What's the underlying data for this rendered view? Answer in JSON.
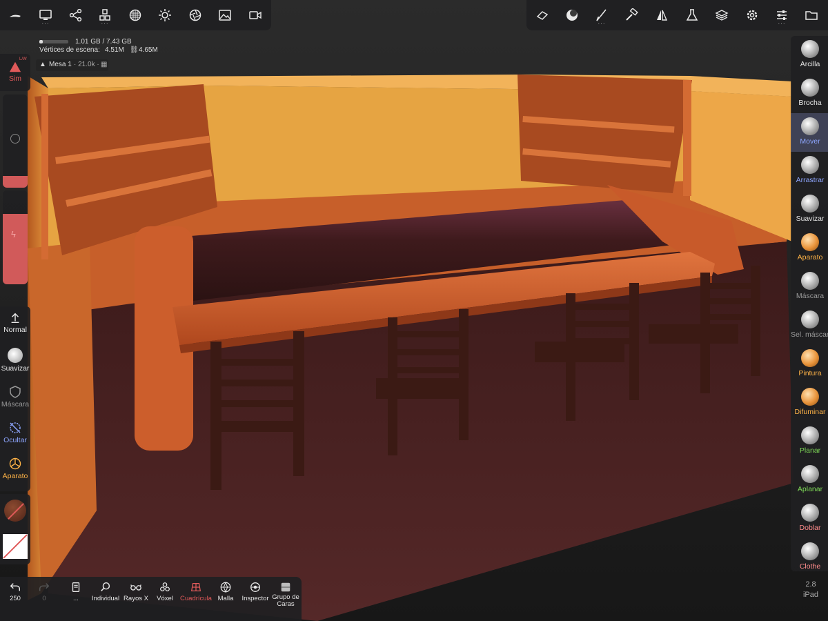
{
  "colors": {
    "accent_red": "#e05a5a",
    "accent_blue": "#8ea6ff",
    "accent_orange": "#ffb347",
    "accent_green": "#7ed957",
    "wall_top": "#e8a24a",
    "wood": "#c85c2c",
    "floor": "#4a2424",
    "chair": "#3a1a14"
  },
  "top_toolbar_left": {
    "icons": [
      "logo-icon",
      "monitor-icon",
      "nodes-icon",
      "cubes-icon",
      "sphere-grid-icon",
      "sun-icon",
      "aperture-icon",
      "image-icon",
      "camera-icon"
    ]
  },
  "top_toolbar_right": {
    "icons": [
      "eraser-icon",
      "material-ball-icon",
      "brush-icon",
      "hammer-icon",
      "symmetry-icon",
      "flask-icon",
      "layers-icon",
      "gear-icon",
      "sliders-icon",
      "folder-icon"
    ]
  },
  "stats": {
    "memory": "1.01 GB / 7.43 GB",
    "vertices_label": "Vértices de escena:",
    "vertices_value": "4.51M",
    "vertices_link": "4.65M",
    "object_name": "Mesa 1",
    "object_count": "· 21.0k ·"
  },
  "left_panel": {
    "sim_label": "Sim",
    "sim_badge": "L/W",
    "normal_label": "Normal",
    "suavizar_label": "Suavizar",
    "mascara_label": "Máscara",
    "ocultar_label": "Ocultar",
    "aparato_label": "Aparato"
  },
  "right_tools": [
    {
      "label": "Arcilla",
      "color": "#e6e6e6"
    },
    {
      "label": "Brocha",
      "color": "#e6e6e6"
    },
    {
      "label": "Mover",
      "color": "#8ea6ff",
      "active": true
    },
    {
      "label": "Arrastrar",
      "color": "#8ea6ff"
    },
    {
      "label": "Suavizar",
      "color": "#e6e6e6"
    },
    {
      "label": "Aparato",
      "color": "#ffb347"
    },
    {
      "label": "Máscara",
      "color": "#9a9a9a"
    },
    {
      "label": "Sel. máscara",
      "color": "#9a9a9a"
    },
    {
      "label": "Pintura",
      "color": "#ffb347"
    },
    {
      "label": "Difuminar",
      "color": "#ffb347"
    },
    {
      "label": "Planar",
      "color": "#7ed957"
    },
    {
      "label": "Aplanar",
      "color": "#7ed957"
    },
    {
      "label": "Doblar",
      "color": "#ff8c8c"
    },
    {
      "label": "Clothe",
      "color": "#ff8c8c"
    }
  ],
  "bottom_bar": {
    "undo_count": "250",
    "redo_count": "0",
    "more_label": "...",
    "buttons": [
      {
        "label": "Individual"
      },
      {
        "label": "Rayos X"
      },
      {
        "label": "Vóxel"
      },
      {
        "label": "Cuadrícula"
      },
      {
        "label": "Malla"
      },
      {
        "label": "Inspector"
      },
      {
        "label": "Grupo de"
      },
      {
        "label": "Caras"
      }
    ]
  },
  "version": {
    "number": "2.8",
    "device": "iPad"
  }
}
